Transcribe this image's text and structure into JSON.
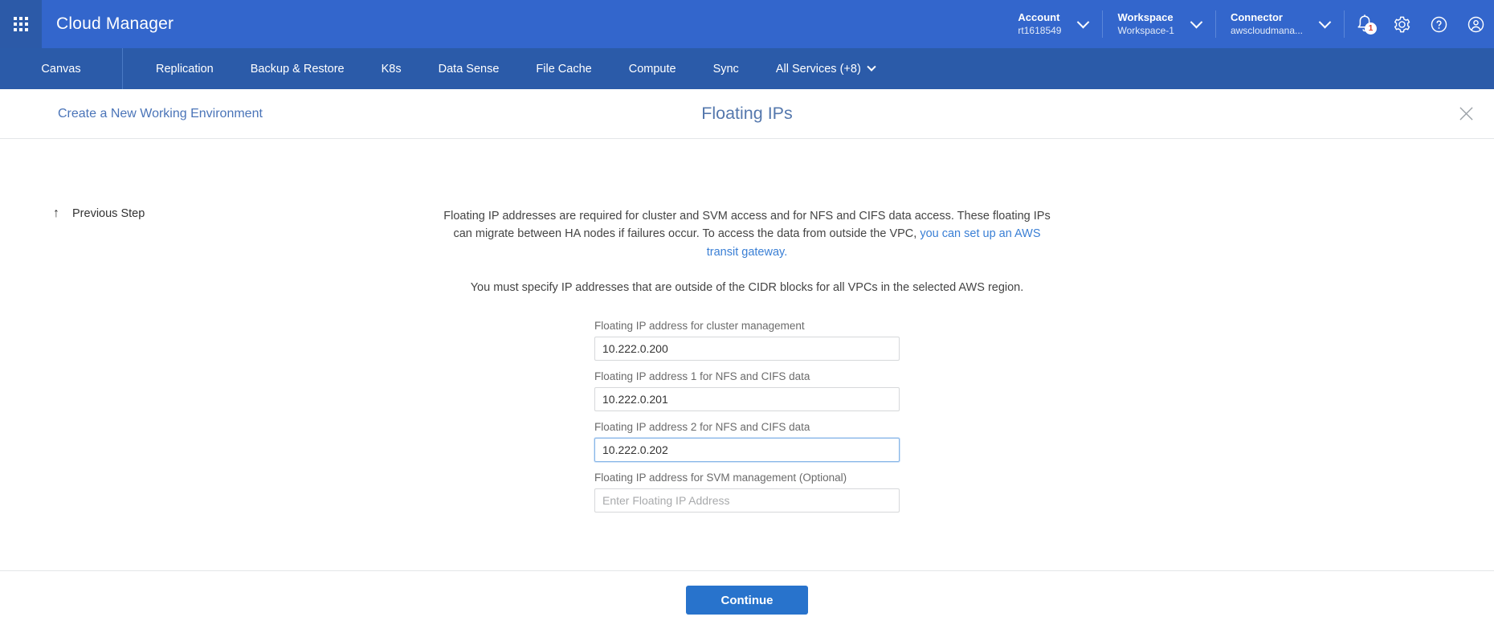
{
  "header": {
    "apps_icon": "grid-apps-icon",
    "brand": "Cloud Manager",
    "account": {
      "label": "Account",
      "value": "rt1618549"
    },
    "workspace": {
      "label": "Workspace",
      "value": "Workspace-1"
    },
    "connector": {
      "label": "Connector",
      "value": "awscloudmana..."
    },
    "notifications": {
      "icon": "bell-icon",
      "badge": "1"
    },
    "settings_icon": "gear-icon",
    "help_icon": "question-circle-icon",
    "account_icon": "user-avatar-icon"
  },
  "nav": {
    "canvas": "Canvas",
    "items": [
      "Replication",
      "Backup & Restore",
      "K8s",
      "Data Sense",
      "File Cache",
      "Compute",
      "Sync"
    ],
    "all_services": "All Services (+8)"
  },
  "wizard": {
    "breadcrumb": "Create a New Working Environment",
    "title": "Floating IPs",
    "close_icon": "close-icon",
    "previous_step": "Previous Step",
    "previous_step_icon": "arrow-up-icon"
  },
  "description": {
    "paragraph1_before_link": "Floating IP addresses are required for cluster and SVM access and for NFS and CIFS data access. These floating IPs can migrate between HA nodes if failures occur. To access the data from outside the VPC, ",
    "paragraph1_link": "you can set up an AWS transit gateway.",
    "paragraph2": "You must specify IP addresses that are outside of the CIDR blocks for all VPCs in the selected AWS region."
  },
  "fields": [
    {
      "label": "Floating IP address for cluster management",
      "value": "10.222.0.200",
      "placeholder": "Enter Floating IP Address",
      "focused": false
    },
    {
      "label": "Floating IP address 1 for NFS and CIFS data",
      "value": "10.222.0.201",
      "placeholder": "Enter Floating IP Address",
      "focused": false
    },
    {
      "label": "Floating IP address 2 for NFS and CIFS data",
      "value": "10.222.0.202",
      "placeholder": "Enter Floating IP Address",
      "focused": true
    },
    {
      "label": "Floating IP address for SVM management (Optional)",
      "value": "",
      "placeholder": "Enter Floating IP Address",
      "focused": false
    }
  ],
  "footer": {
    "continue_label": "Continue"
  },
  "colors": {
    "header_blue": "#3366cc",
    "nav_blue": "#2b5ba9",
    "accent_link": "#3a7fd5",
    "button_blue": "#2873cc",
    "badge_red": "#d83a2b"
  }
}
